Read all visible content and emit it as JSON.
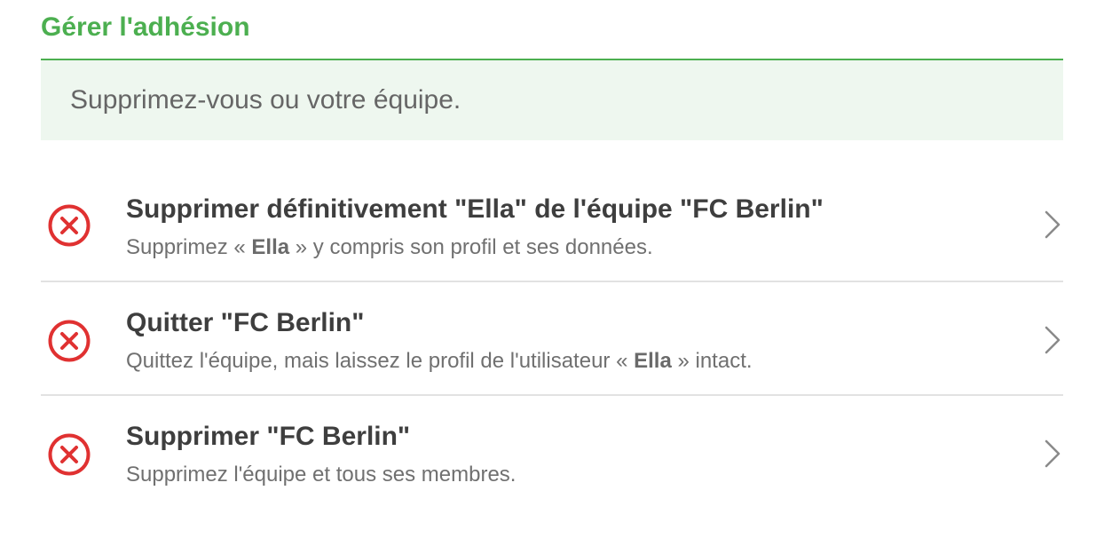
{
  "section_title": "Gérer l'adhésion",
  "notice": "Supprimez-vous ou votre équipe.",
  "colors": {
    "accent": "#4caf50",
    "danger": "#e03131",
    "notice_bg": "#eef7ef"
  },
  "options": [
    {
      "icon": "remove-circle-icon",
      "title": "Supprimer définitivement \"Ella\" de l'équipe \"FC Berlin\"",
      "subtitle_before": "Supprimez « ",
      "subtitle_bold": "Ella",
      "subtitle_after": " » y compris son profil et ses données."
    },
    {
      "icon": "remove-circle-icon",
      "title": "Quitter \"FC Berlin\"",
      "subtitle_before": "Quittez l'équipe, mais laissez le profil de l'utilisateur « ",
      "subtitle_bold": "Ella",
      "subtitle_after": " » intact."
    },
    {
      "icon": "remove-circle-icon",
      "title": "Supprimer \"FC Berlin\"",
      "subtitle_before": "Supprimez l'équipe et tous ses membres.",
      "subtitle_bold": "",
      "subtitle_after": ""
    }
  ]
}
